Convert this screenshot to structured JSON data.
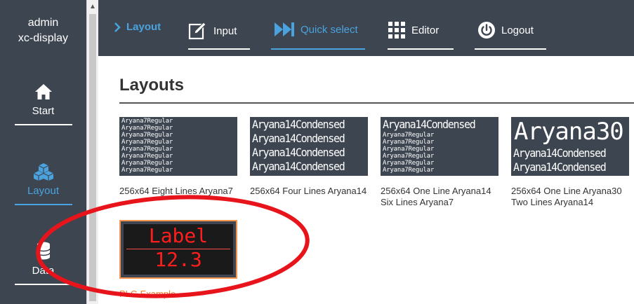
{
  "user": {
    "name": "admin",
    "device": "xc-display"
  },
  "sidebar": {
    "items": [
      {
        "label": "Start",
        "icon": "home-icon"
      },
      {
        "label": "Layout",
        "icon": "cubes-icon",
        "active": true
      },
      {
        "label": "Data",
        "icon": "database-icon"
      }
    ]
  },
  "topbar": {
    "tabs": [
      {
        "label": "Layout",
        "icon": "chevron-right-icon"
      },
      {
        "label": "Input",
        "icon": "edit-icon"
      },
      {
        "label": "Quick select",
        "icon": "fast-forward-icon"
      },
      {
        "label": "Editor",
        "icon": "grid-icon"
      },
      {
        "label": "Logout",
        "icon": "power-icon"
      }
    ]
  },
  "page": {
    "title": "Layouts"
  },
  "layouts": [
    {
      "caption": "256x64 Eight Lines Aryana7",
      "preview": [
        "Aryana7Regular",
        "Aryana7Regular",
        "Aryana7Regular",
        "Aryana7Regular",
        "Aryana7Regular",
        "Aryana7Regular",
        "Aryana7Regular",
        "Aryana7Regular"
      ]
    },
    {
      "caption": "256x64 Four Lines Aryana14",
      "preview": [
        "Aryana14Condensed",
        "Aryana14Condensed",
        "Aryana14Condensed",
        "Aryana14Condensed"
      ]
    },
    {
      "caption": "256x64 One Line Aryana14 Six Lines Aryana7",
      "preview_big": "Aryana14Condensed",
      "preview": [
        "Aryana7Regular",
        "Aryana7Regular",
        "Aryana7Regular",
        "Aryana7Regular",
        "Aryana7Regular",
        "Aryana7Regular"
      ]
    },
    {
      "caption": "256x64 One Line Aryana30 Two Lines Aryana14",
      "preview_big": "Aryana30",
      "preview": [
        "Aryana14Condensed",
        "Aryana14Condensed"
      ]
    },
    {
      "caption": "PLC-Example",
      "preview_label": "Label",
      "preview_value": "12.3"
    }
  ],
  "colors": {
    "sidebar_bg": "#3d4550",
    "accent": "#4aa3df",
    "selected_border": "#f29150",
    "plc_text": "#ff1e1e",
    "annotation": "#e8141b"
  }
}
